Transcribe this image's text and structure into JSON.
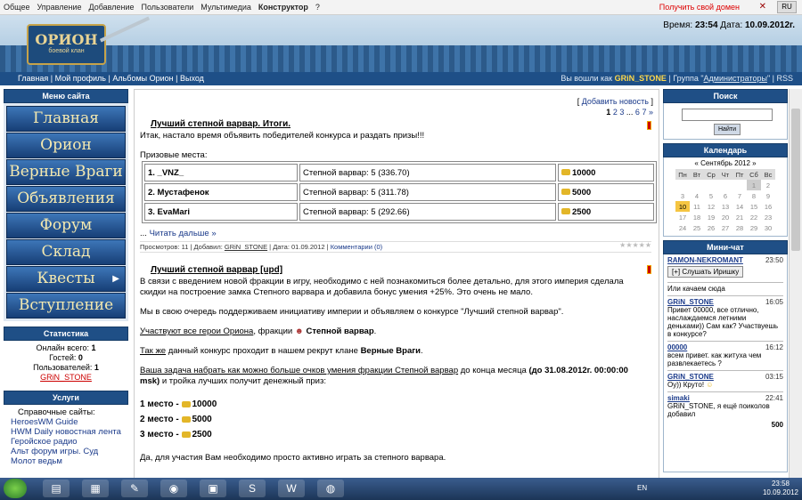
{
  "adminbar": {
    "items": [
      "Общее",
      "Управление",
      "Добавление",
      "Пользователи",
      "Мультимедиа",
      "Конструктор",
      "?"
    ],
    "get_domain": "Получить свой домен"
  },
  "header": {
    "logo_title": "ОРИОН",
    "logo_sub": "боевой клан",
    "clock_label": "Время:",
    "time": "23:54",
    "date_label": "Дата:",
    "date": "10.09.2012г."
  },
  "nav": {
    "links": [
      "Главная",
      "Мой профиль",
      "Альбомы Орион",
      "Выход"
    ],
    "login_text": "Вы вошли как",
    "user": "GRiN_STONE",
    "group_text": "Группа",
    "group": "Администраторы",
    "rss": "RSS"
  },
  "left": {
    "menu_title": "Меню сайта",
    "menu": [
      "Главная",
      "Орион",
      "Верные Враги",
      "Объявления",
      "Форум",
      "Склад",
      "Квесты",
      "Вступление"
    ],
    "stats_title": "Статистика",
    "stats": {
      "online_label": "Онлайн всего:",
      "online": "1",
      "guests_label": "Гостей:",
      "guests": "0",
      "users_label": "Пользователей:",
      "users": "1",
      "user": "GRiN_STONE"
    },
    "services_title": "Услуги",
    "services_head": "Справочные сайты:",
    "services": [
      "HeroesWM Guide",
      "HWM Daily новостная лента",
      "Геройское радио",
      "Альт форум игры. Суд",
      "Молот ведьм"
    ]
  },
  "main": {
    "add_news": "Добавить новость",
    "pages": [
      "1",
      "2",
      "3",
      "...",
      "6",
      "7",
      "»"
    ],
    "news1": {
      "title": "Лучший степной варвар. Итоги.",
      "intro": "Итак, настало время объявить победителей конкурса и раздать призы!!!",
      "places_label": "Призовые места:",
      "rows": [
        {
          "name": "1. _VNZ_",
          "result": "Степной варвар: 5 (336.70)",
          "prize": "10000"
        },
        {
          "name": "2. Мустафенок",
          "result": "Степной варвар: 5 (311.78)",
          "prize": "5000"
        },
        {
          "name": "3. EvaMari",
          "result": "Степной варвар: 5 (292.66)",
          "prize": "2500"
        }
      ],
      "read_more": "Читать дальше »",
      "meta": {
        "views_label": "Просмотров:",
        "views": "11",
        "added_label": "Добавил:",
        "author": "GRiN_STONE",
        "date_label": "Дата:",
        "date": "01.09.2012",
        "comments": "Комментарии (0)"
      }
    },
    "news2": {
      "title": "Лучший степной варвар [upd]",
      "p1": "В связи с введением новой фракции в игру, необходимо с ней познакомиться более детально, для этого империя сделала скидки на построение замка Степного варвара и добавила бонус умения +25%. Это очень не мало.",
      "p2": "Мы в свою очередь поддерживаем инициативу империи и объявляем о конкурсе \"Лучший степной варвар\".",
      "p3a": "Участвуют все герои Ориона",
      "p3b": ", фракции",
      "p3c": "Степной варвар",
      "p4a": "Так же",
      "p4b": " данный конкурс проходит в нашем рекрут клане ",
      "p4c": "Верные Враги",
      "p5a": "Ваша задача набрать как можно больше очков умения фракции Степной варвар",
      "p5b": " до конца месяца ",
      "p5c": "(до 31.08.2012г. 00:00:00 msk)",
      "p5d": " и тройка лучших получит денежный приз:",
      "winners": [
        {
          "place": "1 место -",
          "prize": "10000"
        },
        {
          "place": "2 место -",
          "prize": "5000"
        },
        {
          "place": "3 место -",
          "prize": "2500"
        }
      ],
      "p6": "Да, для участия Вам необходимо просто активно играть за степного варвара."
    }
  },
  "right": {
    "search_title": "Поиск",
    "search_btn": "Найти",
    "calendar_title": "Календарь",
    "month": "Сентябрь 2012",
    "weekdays": [
      "Пн",
      "Вт",
      "Ср",
      "Чт",
      "Пт",
      "Сб",
      "Вс"
    ],
    "days": [
      "",
      "",
      "",
      "",
      "",
      "1",
      "2",
      "3",
      "4",
      "5",
      "6",
      "7",
      "8",
      "9",
      "10",
      "11",
      "12",
      "13",
      "14",
      "15",
      "16",
      "17",
      "18",
      "19",
      "20",
      "21",
      "22",
      "23",
      "24",
      "25",
      "26",
      "27",
      "28",
      "29",
      "30"
    ],
    "chat_title": "Мини-чат",
    "chat": [
      {
        "nick": "RAMON-NEKROMANT",
        "time": "23:50",
        "text": "[+] Слушать Иришку"
      },
      {
        "nick": "",
        "time": "",
        "text": "Или качаем сюда"
      },
      {
        "nick": "GRiN_STONE",
        "time": "16:05",
        "text": "Привет 00000, все отлично, наслаждаемся летними деньками)) Сам как? Участвуешь в конкурсе?"
      },
      {
        "nick": "00000",
        "time": "16:12",
        "text": "всем привет. как житуха чем развлекаетесь ?"
      },
      {
        "nick": "GRiN_STONE",
        "time": "03:15",
        "text": "Оу)) Круто!"
      },
      {
        "nick": "simaki",
        "time": "22:41",
        "text": "GRiN_STONE, я ещё поиколов добавил"
      }
    ],
    "chat_count": "500"
  },
  "taskbar": {
    "lang": "EN",
    "time": "23:58",
    "date": "10.09.2012"
  }
}
